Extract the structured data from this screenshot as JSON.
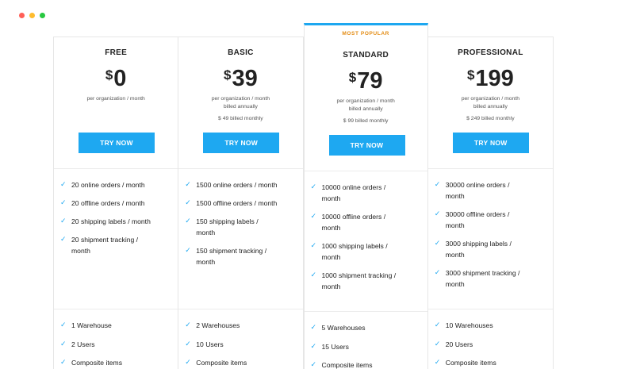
{
  "window": {
    "dot_colors": [
      "#ff5f57",
      "#febc2e",
      "#28c840"
    ]
  },
  "popular_label": "MOST POPULAR",
  "accent": "#1ea8f1",
  "plans": [
    {
      "name": "FREE",
      "currency": "$",
      "price": "0",
      "sub1": "per organization / month",
      "sub2": "",
      "monthly": "",
      "button": "TRY NOW",
      "features": [
        "20 online orders / month",
        "20 offline orders / month",
        "20 shipping labels / month",
        "20 shipment tracking / month"
      ],
      "extras": [
        "1 Warehouse",
        "2 Users",
        "Composite items"
      ]
    },
    {
      "name": "BASIC",
      "currency": "$",
      "price": "39",
      "sub1": "per organization / month",
      "sub2": "billed annually",
      "monthly": "$ 49 billed monthly",
      "button": "TRY NOW",
      "features": [
        "1500 online orders / month",
        "1500 offline orders / month",
        "150 shipping labels / month",
        "150 shipment tracking / month"
      ],
      "extras": [
        "2 Warehouses",
        "10 Users",
        "Composite items"
      ]
    },
    {
      "name": "STANDARD",
      "currency": "$",
      "price": "79",
      "sub1": "per organization / month",
      "sub2": "billed annually",
      "monthly": "$ 99 billed monthly",
      "button": "TRY NOW",
      "features": [
        "10000 online orders / month",
        "10000 offline orders / month",
        "1000 shipping labels / month",
        "1000 shipment tracking / month"
      ],
      "extras": [
        "5 Warehouses",
        "15 Users",
        "Composite items"
      ]
    },
    {
      "name": "PROFESSIONAL",
      "currency": "$",
      "price": "199",
      "sub1": "per organization / month",
      "sub2": "billed annually",
      "monthly": "$ 249 billed monthly",
      "button": "TRY NOW",
      "features": [
        "30000 online orders / month",
        "30000 offline orders / month",
        "3000 shipping labels / month",
        "3000 shipment tracking / month"
      ],
      "extras": [
        "10 Warehouses",
        "20 Users",
        "Composite items"
      ]
    }
  ]
}
